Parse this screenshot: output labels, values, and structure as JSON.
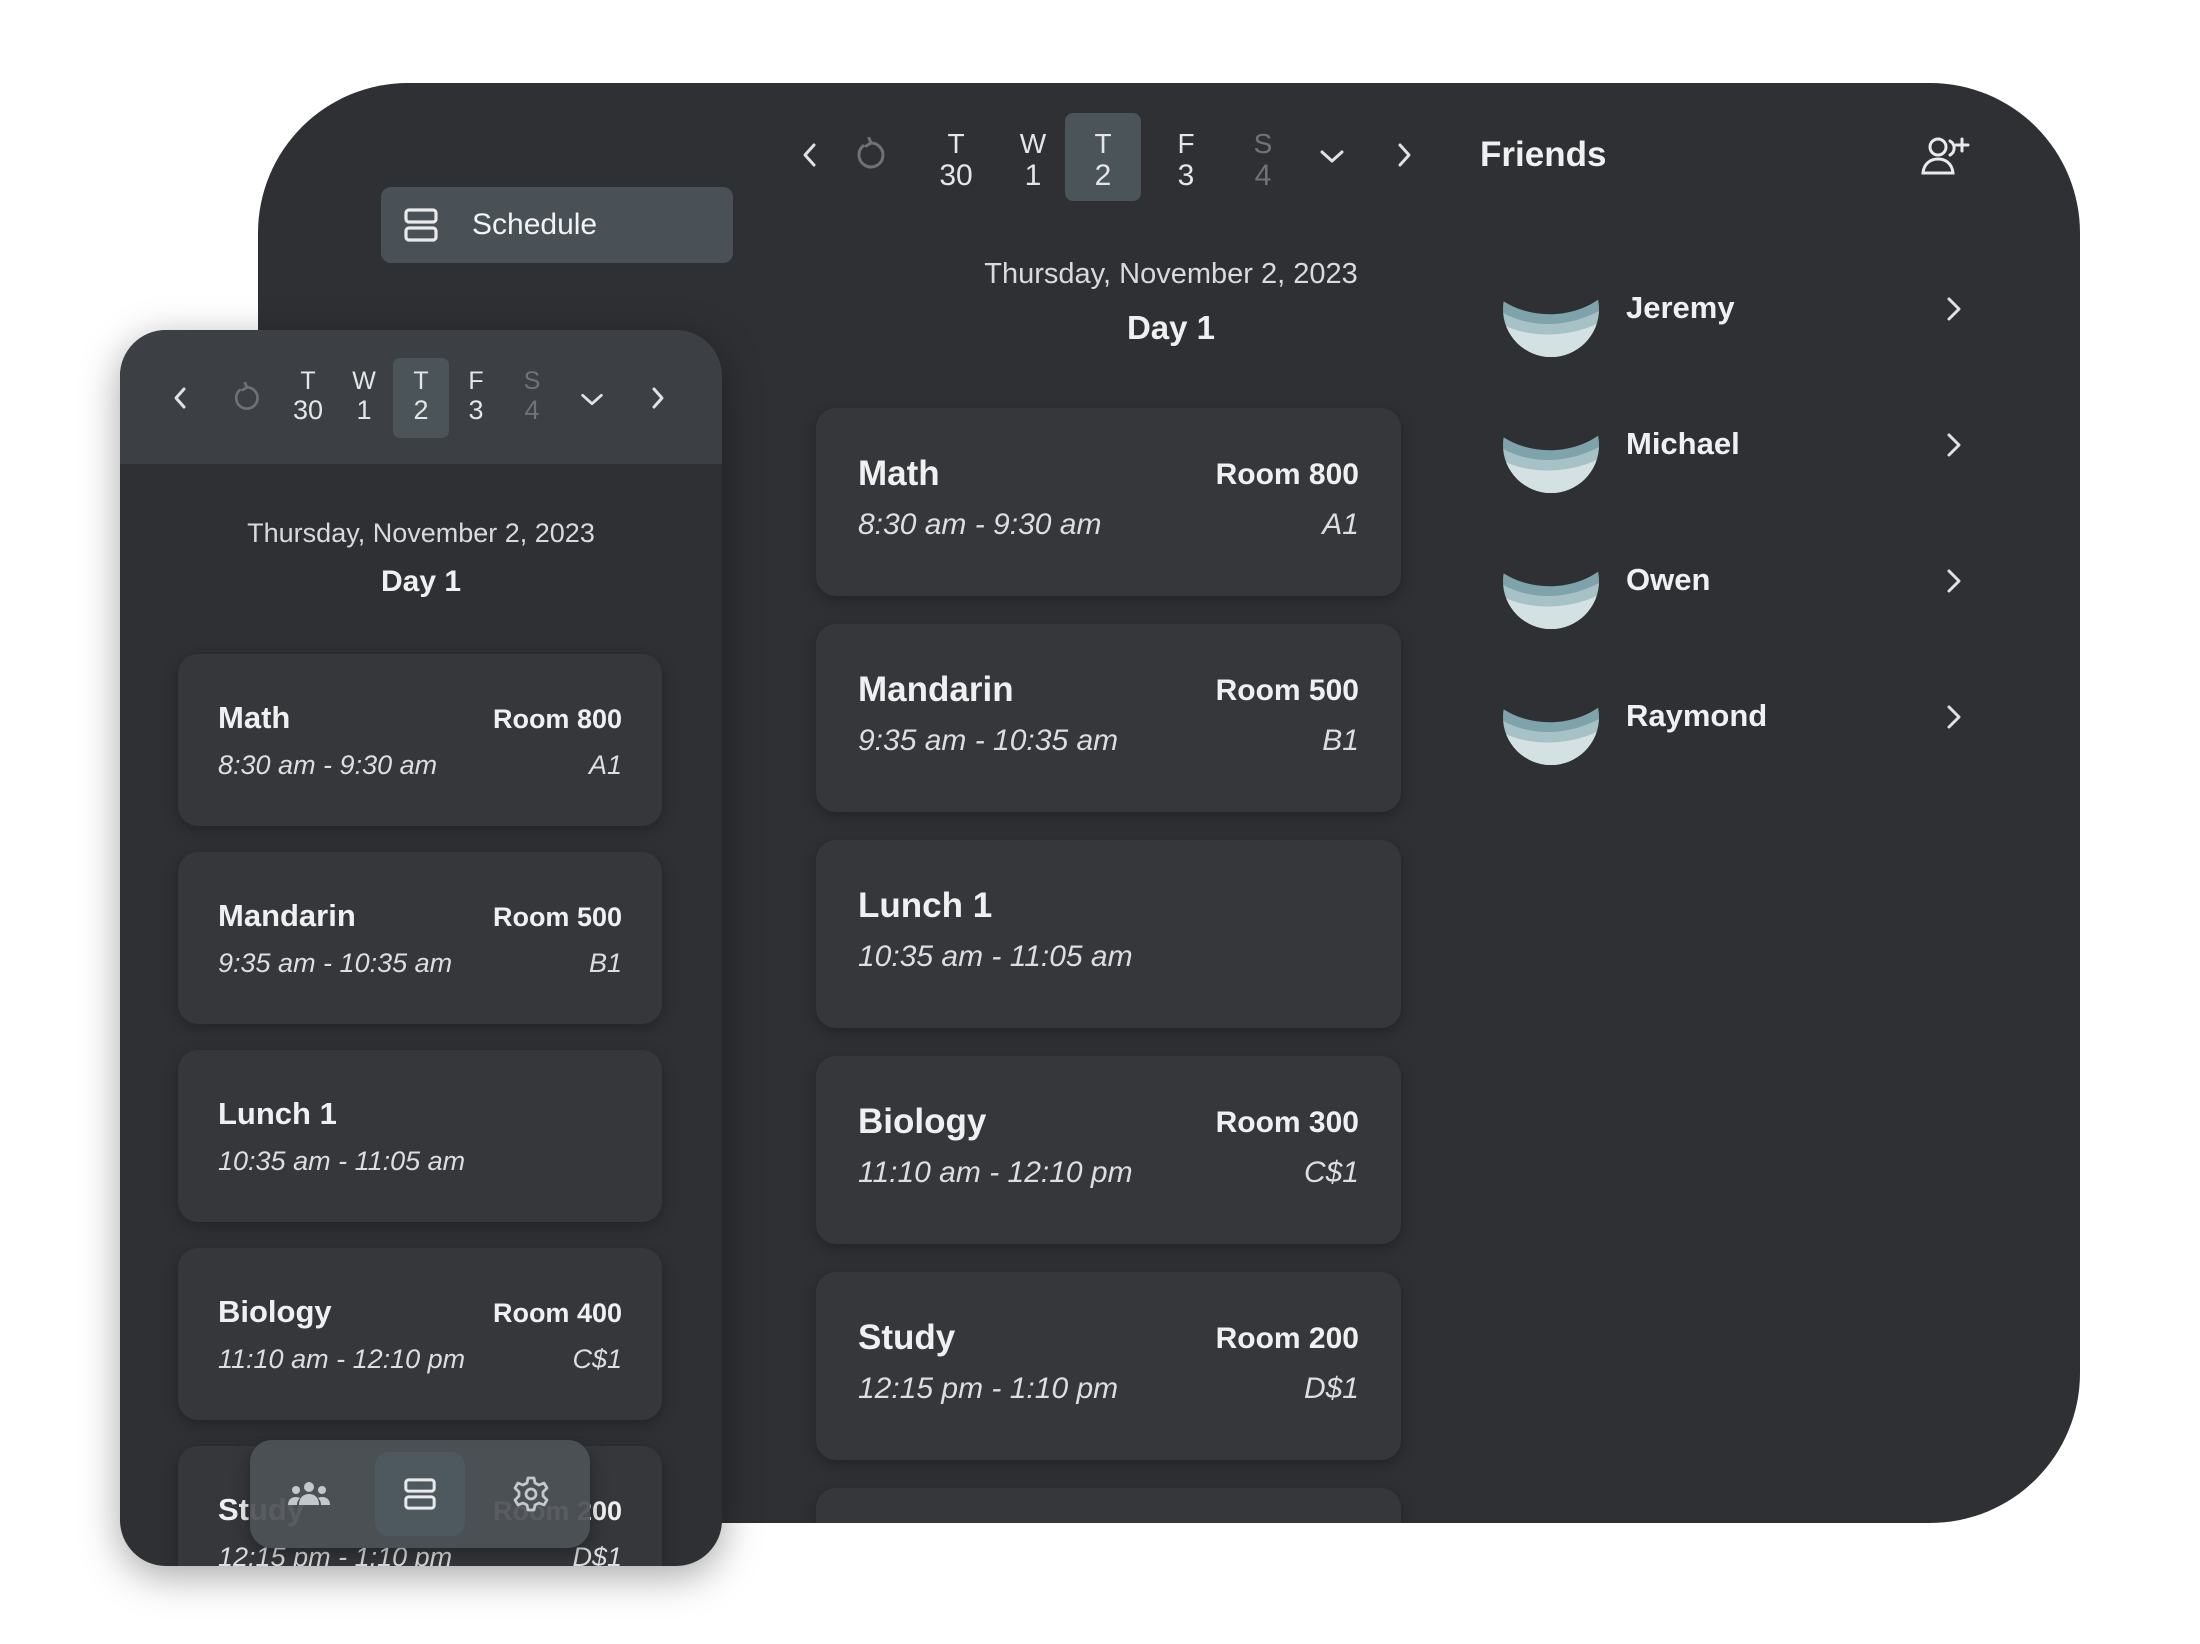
{
  "sidebar": {
    "schedule_label": "Schedule"
  },
  "day_nav": {
    "days": [
      {
        "letter": "T",
        "num": "30"
      },
      {
        "letter": "W",
        "num": "1"
      },
      {
        "letter": "T",
        "num": "2"
      },
      {
        "letter": "F",
        "num": "3"
      },
      {
        "letter": "S",
        "num": "4"
      }
    ],
    "selected_index": 2
  },
  "schedule": {
    "date": "Thursday, November 2, 2023",
    "day_label": "Day 1",
    "desktop_classes": [
      {
        "name": "Math",
        "room": "Room 800",
        "time": "8:30 am - 9:30 am",
        "block": "A1"
      },
      {
        "name": "Mandarin",
        "room": "Room 500",
        "time": "9:35 am - 10:35 am",
        "block": "B1"
      },
      {
        "name": "Lunch 1",
        "room": "",
        "time": "10:35 am - 11:05 am",
        "block": ""
      },
      {
        "name": "Biology",
        "room": "Room 300",
        "time": "11:10 am - 12:10 pm",
        "block": "C$1"
      },
      {
        "name": "Study",
        "room": "Room 200",
        "time": "12:15 pm - 1:10 pm",
        "block": "D$1"
      }
    ],
    "mobile_classes": [
      {
        "name": "Math",
        "room": "Room 800",
        "time": "8:30 am - 9:30 am",
        "block": "A1"
      },
      {
        "name": "Mandarin",
        "room": "Room 500",
        "time": "9:35 am - 10:35 am",
        "block": "B1"
      },
      {
        "name": "Lunch 1",
        "room": "",
        "time": "10:35 am - 11:05 am",
        "block": ""
      },
      {
        "name": "Biology",
        "room": "Room 400",
        "time": "11:10 am - 12:10 pm",
        "block": "C$1"
      },
      {
        "name": "Study",
        "room": "Room 200",
        "time": "12:15 pm - 1:10 pm",
        "block": "D$1"
      }
    ]
  },
  "friends": {
    "title": "Friends",
    "list": [
      "Jeremy",
      "Michael",
      "Owen",
      "Raymond"
    ]
  },
  "tabbar": {
    "tabs": [
      "friends-icon",
      "schedule-icon",
      "settings-icon"
    ],
    "selected_index": 1
  },
  "colors": {
    "background": "#2e3034",
    "card": "#35373b",
    "selected": "#4a5459",
    "avatar": "#7fa3aa"
  }
}
